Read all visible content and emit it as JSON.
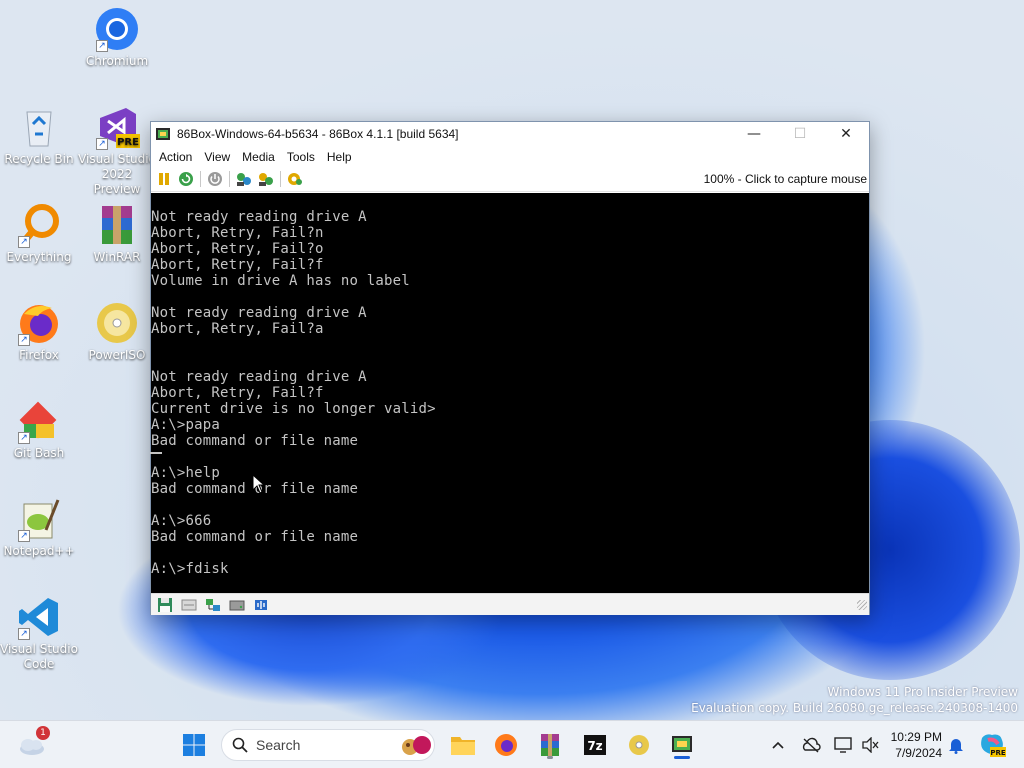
{
  "desktop": {
    "icons": [
      {
        "label": "Chromium",
        "icon": "chromium-icon"
      },
      {
        "label": "Recycle Bin",
        "icon": "recycle-bin-icon"
      },
      {
        "label": "Visual Studio 2022 Preview",
        "icon": "visual-studio-icon",
        "badge": "PRE"
      },
      {
        "label": "Everything",
        "icon": "everything-search-icon"
      },
      {
        "label": "WinRAR",
        "icon": "winrar-icon"
      },
      {
        "label": "Firefox",
        "icon": "firefox-icon"
      },
      {
        "label": "PowerISO",
        "icon": "poweriso-icon"
      },
      {
        "label": "Git Bash",
        "icon": "git-bash-icon"
      },
      {
        "label": "Notepad++",
        "icon": "notepad-plus-plus-icon"
      },
      {
        "label": "Visual Studio Code",
        "icon": "vscode-icon"
      }
    ],
    "watermark": {
      "line1": "Windows 11 Pro Insider Preview",
      "line2": "Evaluation copy. Build 26080.ge_release.240308-1400"
    }
  },
  "window": {
    "title": "86Box-Windows-64-b5634 - 86Box 4.1.1 [build 5634]",
    "controls": {
      "minimize": "—",
      "maximize": "☐",
      "close": "✕"
    },
    "menu": [
      "Action",
      "View",
      "Media",
      "Tools",
      "Help"
    ],
    "toolbar": {
      "buttons": [
        "pause-icon",
        "reset-icon",
        "power-icon",
        "ctrl-alt-del-icon",
        "ctrl-alt-esc-icon",
        "settings-icon"
      ],
      "capture_text": "100% - Click to capture mouse"
    },
    "terminal": {
      "lines": [
        "Not ready reading drive A",
        "Abort, Retry, Fail?n",
        "Abort, Retry, Fail?o",
        "Abort, Retry, Fail?f",
        "Volume in drive A has no label",
        "",
        "Not ready reading drive A",
        "Abort, Retry, Fail?a",
        "",
        "",
        "Not ready reading drive A",
        "Abort, Retry, Fail?f",
        "Current drive is no longer valid>",
        "A:\\>papa",
        "Bad command or file name",
        "",
        "A:\\>help",
        "Bad command or file name",
        "",
        "A:\\>666",
        "Bad command or file name",
        "",
        "A:\\>fdisk"
      ]
    },
    "statusbar": [
      "floppy-drive-icon",
      "cdrom-drive-icon",
      "network-icon",
      "hard-disk-icon",
      "sound-icon"
    ]
  },
  "taskbar": {
    "search_placeholder": "Search",
    "weather_badge": "1",
    "apps": [
      "start-icon",
      "search-icon",
      "file-explorer-icon",
      "firefox-icon",
      "winrar-icon",
      "7zip-icon",
      "poweriso-icon",
      "86box-icon"
    ],
    "tray": [
      "chevron-up-icon",
      "onedrive-icon",
      "display-icon",
      "volume-icon"
    ],
    "time": "10:29 PM",
    "date": "7/9/2024",
    "copilot_badge": "PRE"
  },
  "colors": {
    "terminal_fg": "#c4c4c4",
    "terminal_bg": "#000000",
    "accent": "#1a5fd6"
  }
}
